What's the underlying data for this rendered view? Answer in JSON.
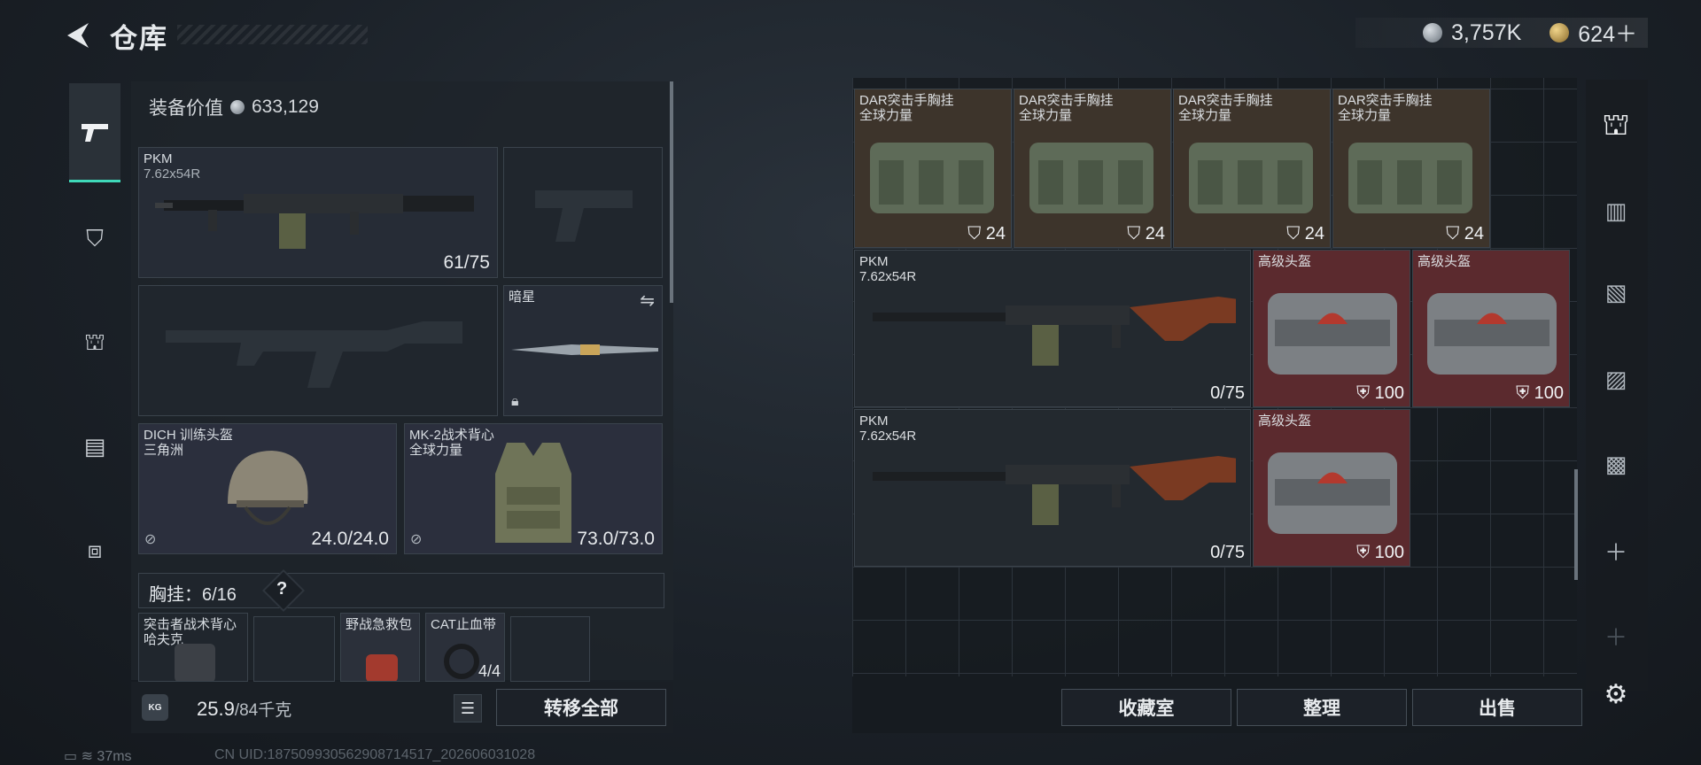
{
  "header": {
    "title": "仓库",
    "currency_silver": "3,757K",
    "currency_gold": "624＋"
  },
  "equipment": {
    "value_label": "装备价值",
    "value": "633,129",
    "primary": {
      "name": "PKM",
      "ammo_type": "7.62x54R",
      "ammo": "61/75"
    },
    "melee": {
      "name": "暗星"
    },
    "helmet": {
      "name": "DICH 训练头盔",
      "faction": "三角洲",
      "durability": "24.0/24.0"
    },
    "armor": {
      "name": "MK-2战术背心",
      "faction": "全球力量",
      "durability": "73.0/73.0"
    },
    "chest_rig": {
      "label": "胸挂：",
      "capacity": "6/16",
      "help": "?"
    },
    "rig_items": [
      {
        "name": "突击者战术背心",
        "sub": "哈夫克"
      },
      {
        "name": "野战急救包",
        "sub": ""
      },
      {
        "name": "CAT止血带",
        "count": "4/4"
      }
    ]
  },
  "footer_left": {
    "weight": "25.9",
    "weight_max": "/84千克",
    "weight_icon": "KG",
    "transfer_all": "转移全部"
  },
  "storage": {
    "chest_rigs": [
      {
        "name": "DAR突击手胸挂",
        "faction": "全球力量",
        "count": "24"
      },
      {
        "name": "DAR突击手胸挂",
        "faction": "全球力量",
        "count": "24"
      },
      {
        "name": "DAR突击手胸挂",
        "faction": "全球力量",
        "count": "24"
      },
      {
        "name": "DAR突击手胸挂",
        "faction": "全球力量",
        "count": "24"
      }
    ],
    "guns": [
      {
        "name": "PKM",
        "ammo_type": "7.62x54R",
        "ammo": "0/75"
      },
      {
        "name": "PKM",
        "ammo_type": "7.62x54R",
        "ammo": "0/75"
      }
    ],
    "helmets": [
      {
        "name": "高级头盔",
        "count": "100"
      },
      {
        "name": "高级头盔",
        "count": "100"
      },
      {
        "name": "高级头盔",
        "count": "100"
      }
    ],
    "buttons": {
      "collection": "收藏室",
      "sort": "整理",
      "sell": "出售"
    }
  },
  "status": {
    "ping": "37ms",
    "uid": "CN UID:18750993056290871451​7_202606031028"
  },
  "colors": {
    "accent": "#3fd9b9",
    "red_cell": "#5b2a2e",
    "brown_cell": "#3d342b"
  },
  "icons": [
    "back-arrow-icon",
    "silver-coin-icon",
    "gold-coin-icon",
    "pistol-icon",
    "vest-icon",
    "backpack-icon",
    "case-icon",
    "toolbox-icon",
    "lock-icon",
    "swap-icon",
    "settings-icon",
    "plus-icon"
  ]
}
